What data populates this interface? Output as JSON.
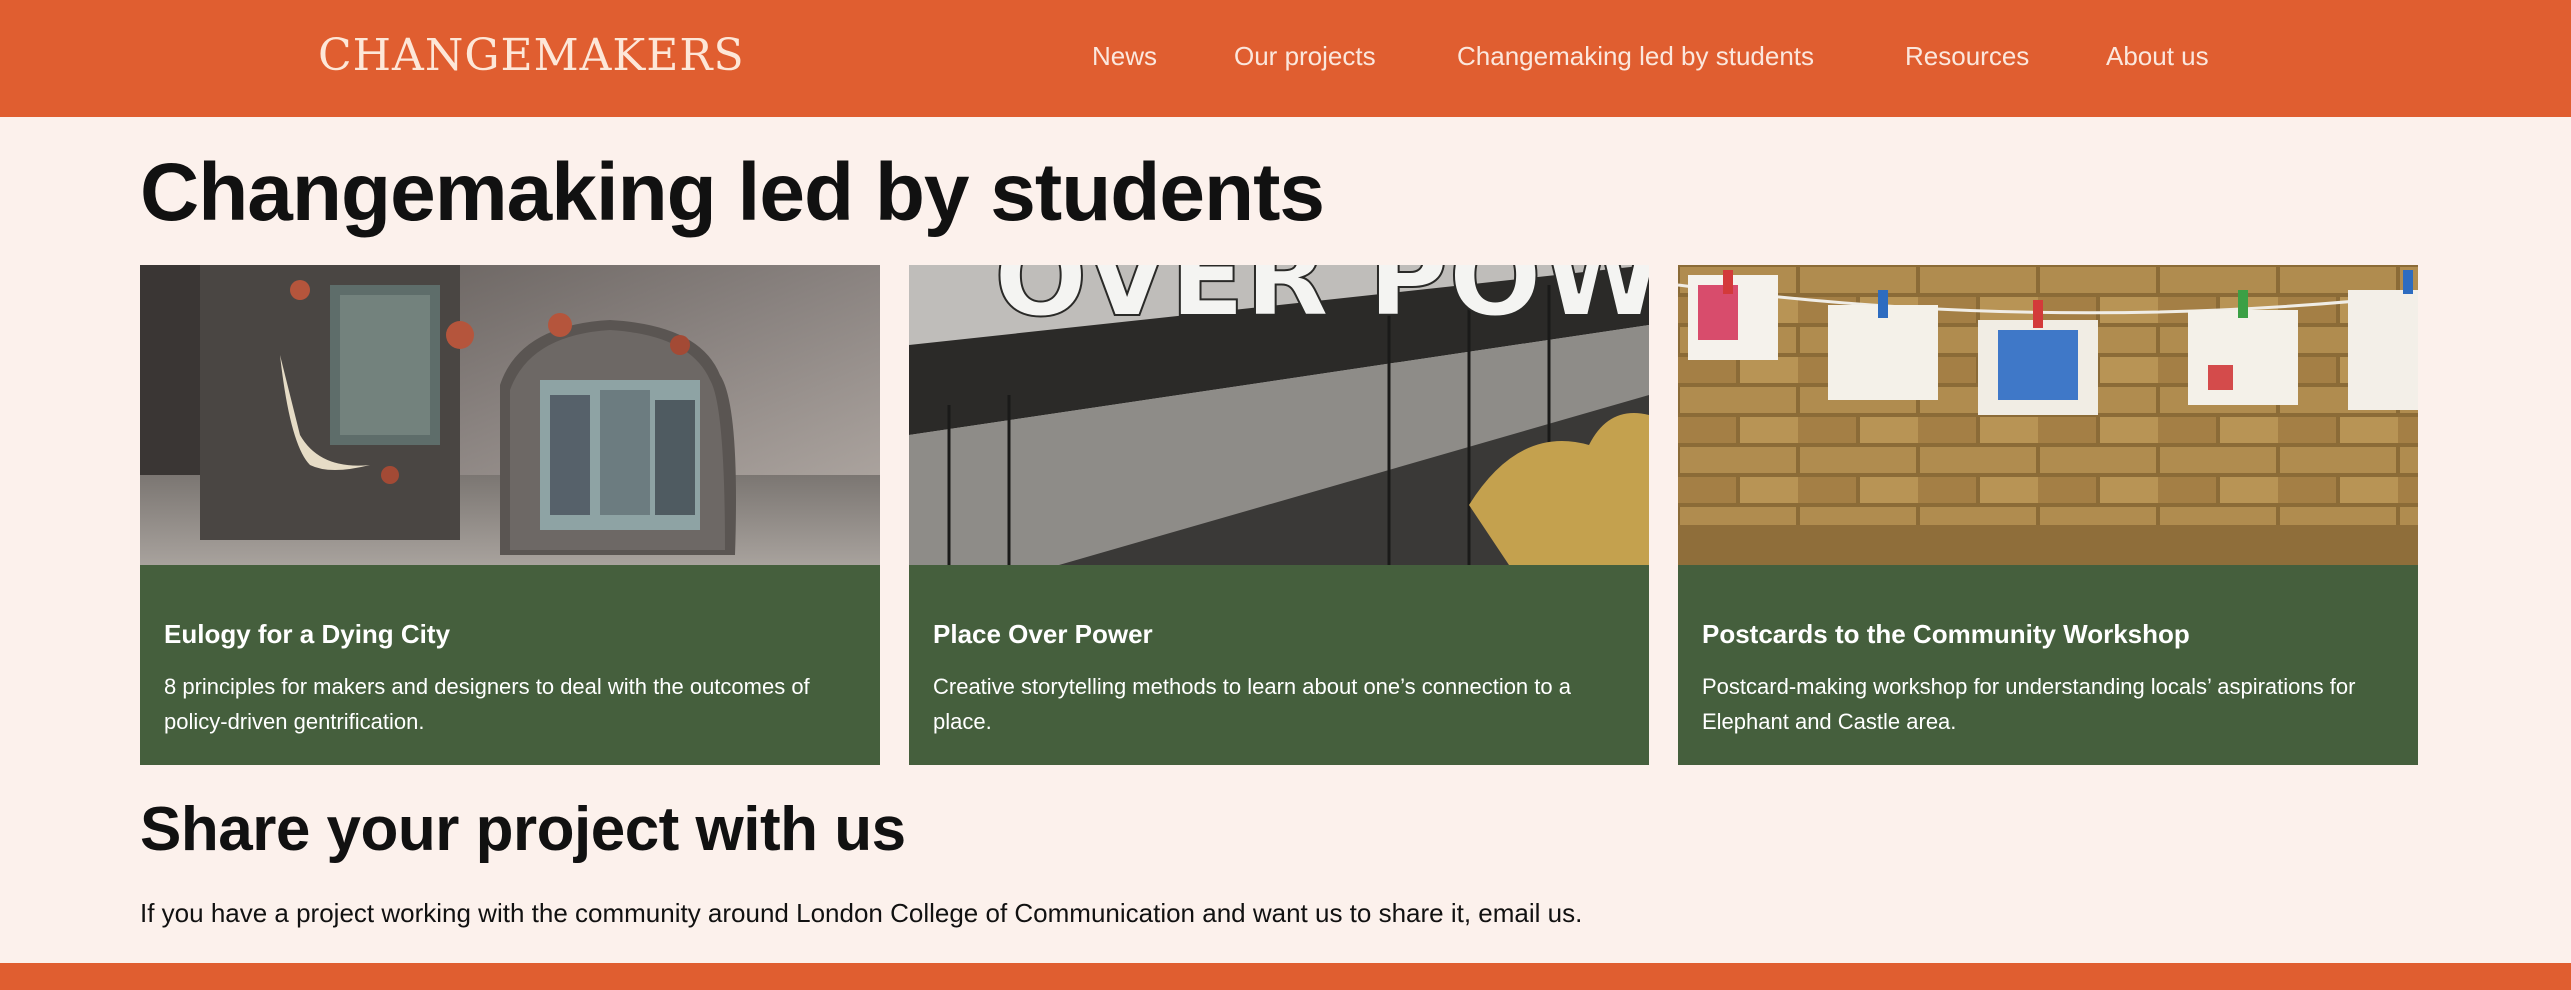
{
  "brand": {
    "logo_text": "CHANGEMAKERS",
    "accent_color": "#e05e30",
    "card_color": "#455f3d",
    "background_color": "#fcf1ec"
  },
  "nav": {
    "items": [
      {
        "label": "News"
      },
      {
        "label": "Our projects"
      },
      {
        "label": "Changemaking led by students"
      },
      {
        "label": "Resources"
      },
      {
        "label": "About us"
      }
    ]
  },
  "main": {
    "title": "Changemaking led by students",
    "cards": [
      {
        "title": "Eulogy for a Dying City",
        "description": "8 principles for makers and designers to deal with the outcomes of policy-driven gentrification."
      },
      {
        "title": "Place Over Power",
        "description": "Creative storytelling methods to learn about one’s connection to a place.",
        "image_text": "OVER POWER"
      },
      {
        "title": "Postcards to the Community Workshop",
        "description": "Postcard-making workshop for understanding locals’ aspirations for Elephant and Castle area."
      }
    ]
  },
  "share": {
    "title": "Share your project with us",
    "text": "If you have a project working with the community around London College of Communication and want us to share it, email us."
  }
}
